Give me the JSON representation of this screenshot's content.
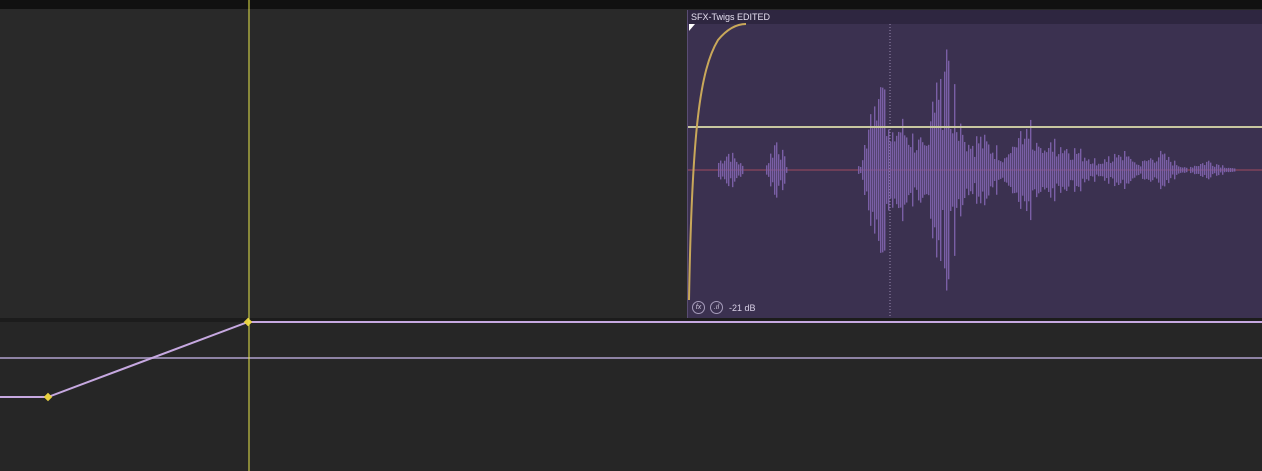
{
  "timeline": {
    "upper_track": {
      "clip": {
        "name": "SFX-Twigs EDITED",
        "gain": "-21 dB",
        "fx_icon": "fx-icon",
        "volume_icon": "volume-level-icon",
        "colors": {
          "body": "#3b3150",
          "header": "#2e2640",
          "waveform": "#7a5fa6",
          "fade_curve": "#c9a85a",
          "volume_line": "#c8c7a0",
          "center_line": "#a04a60"
        }
      }
    },
    "lower_track": {
      "automation_color": "#c6a8e0",
      "keyframe_color": "#e8d040"
    },
    "playhead": {
      "color": "#e8e64a"
    }
  }
}
